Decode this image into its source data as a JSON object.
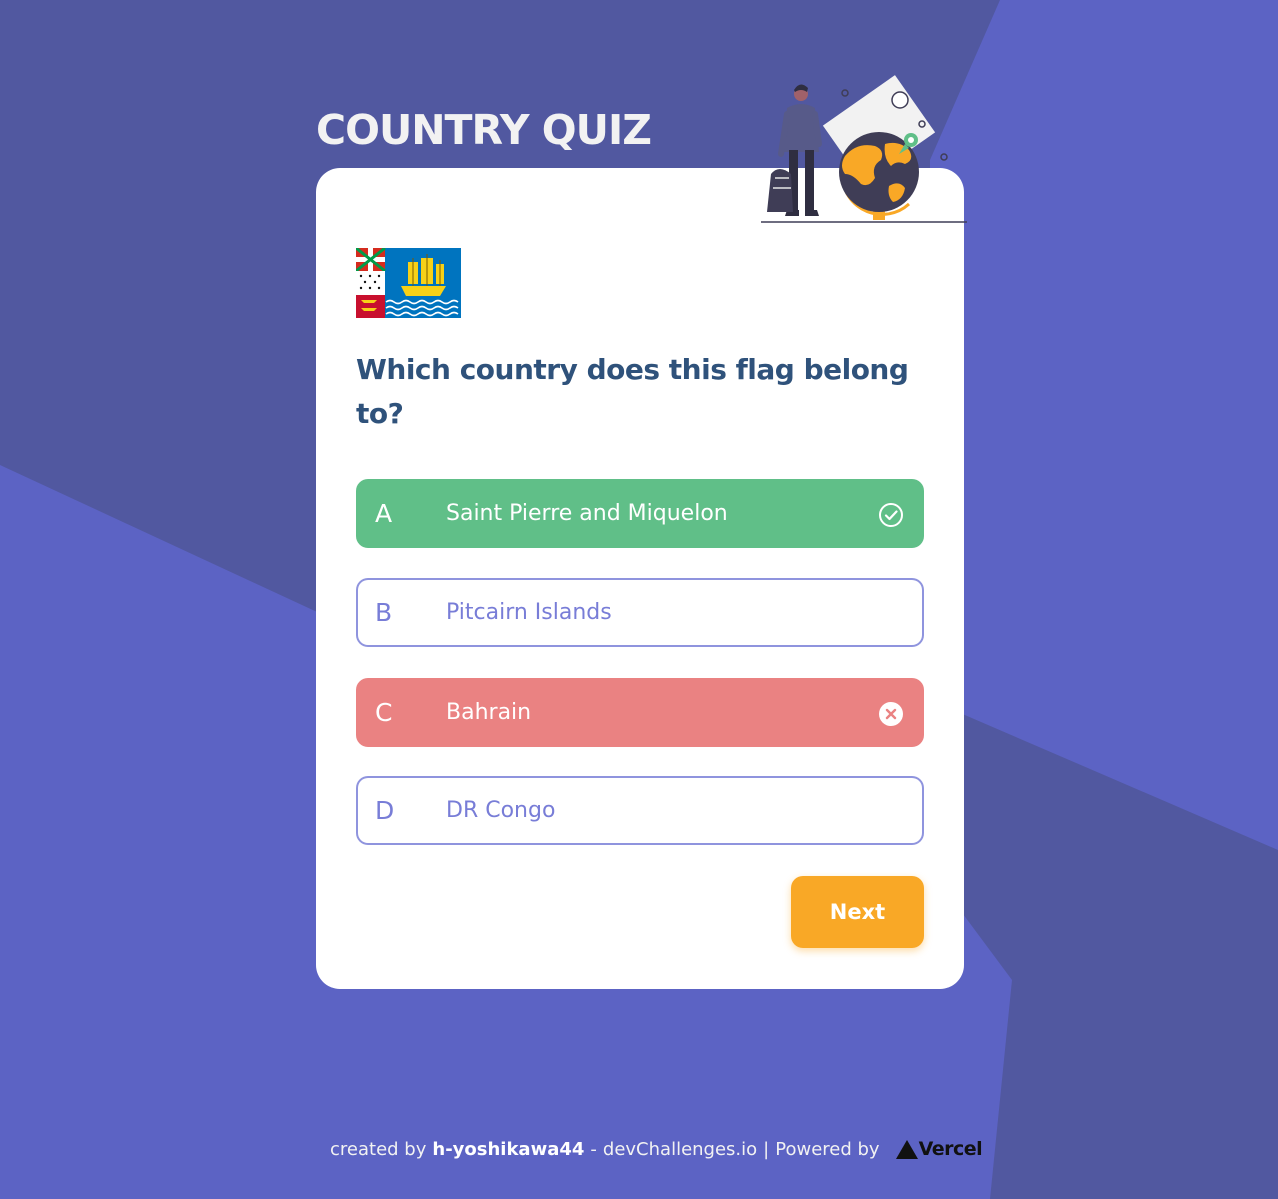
{
  "app": {
    "title": "COUNTRY QUIZ"
  },
  "question": {
    "text": "Which country does this flag belong to?",
    "flag_icon": "saint-pierre-and-miquelon-flag"
  },
  "options": [
    {
      "letter": "A",
      "text": "Saint Pierre and Miquelon",
      "state": "correct",
      "icon": "check-circle-icon"
    },
    {
      "letter": "B",
      "text": "Pitcairn Islands",
      "state": "default"
    },
    {
      "letter": "C",
      "text": "Bahrain",
      "state": "wrong",
      "icon": "close-circle-icon"
    },
    {
      "letter": "D",
      "text": "DR Congo",
      "state": "default"
    }
  ],
  "actions": {
    "next_label": "Next"
  },
  "footer": {
    "prefix": "created by",
    "author": "h-yoshikawa44",
    "dash": "-",
    "site": "devChallenges.io",
    "divider": "|",
    "powered_by": "Powered by",
    "vercel": "Vercel"
  },
  "colors": {
    "background": "#5c63c4",
    "background_dark": "#5158a0",
    "title": "#f2f2f2",
    "question": "#2f527b",
    "option_border": "#6066d0",
    "correct": "#60bf88",
    "wrong": "#ea8282",
    "next_button": "#f9a826"
  }
}
